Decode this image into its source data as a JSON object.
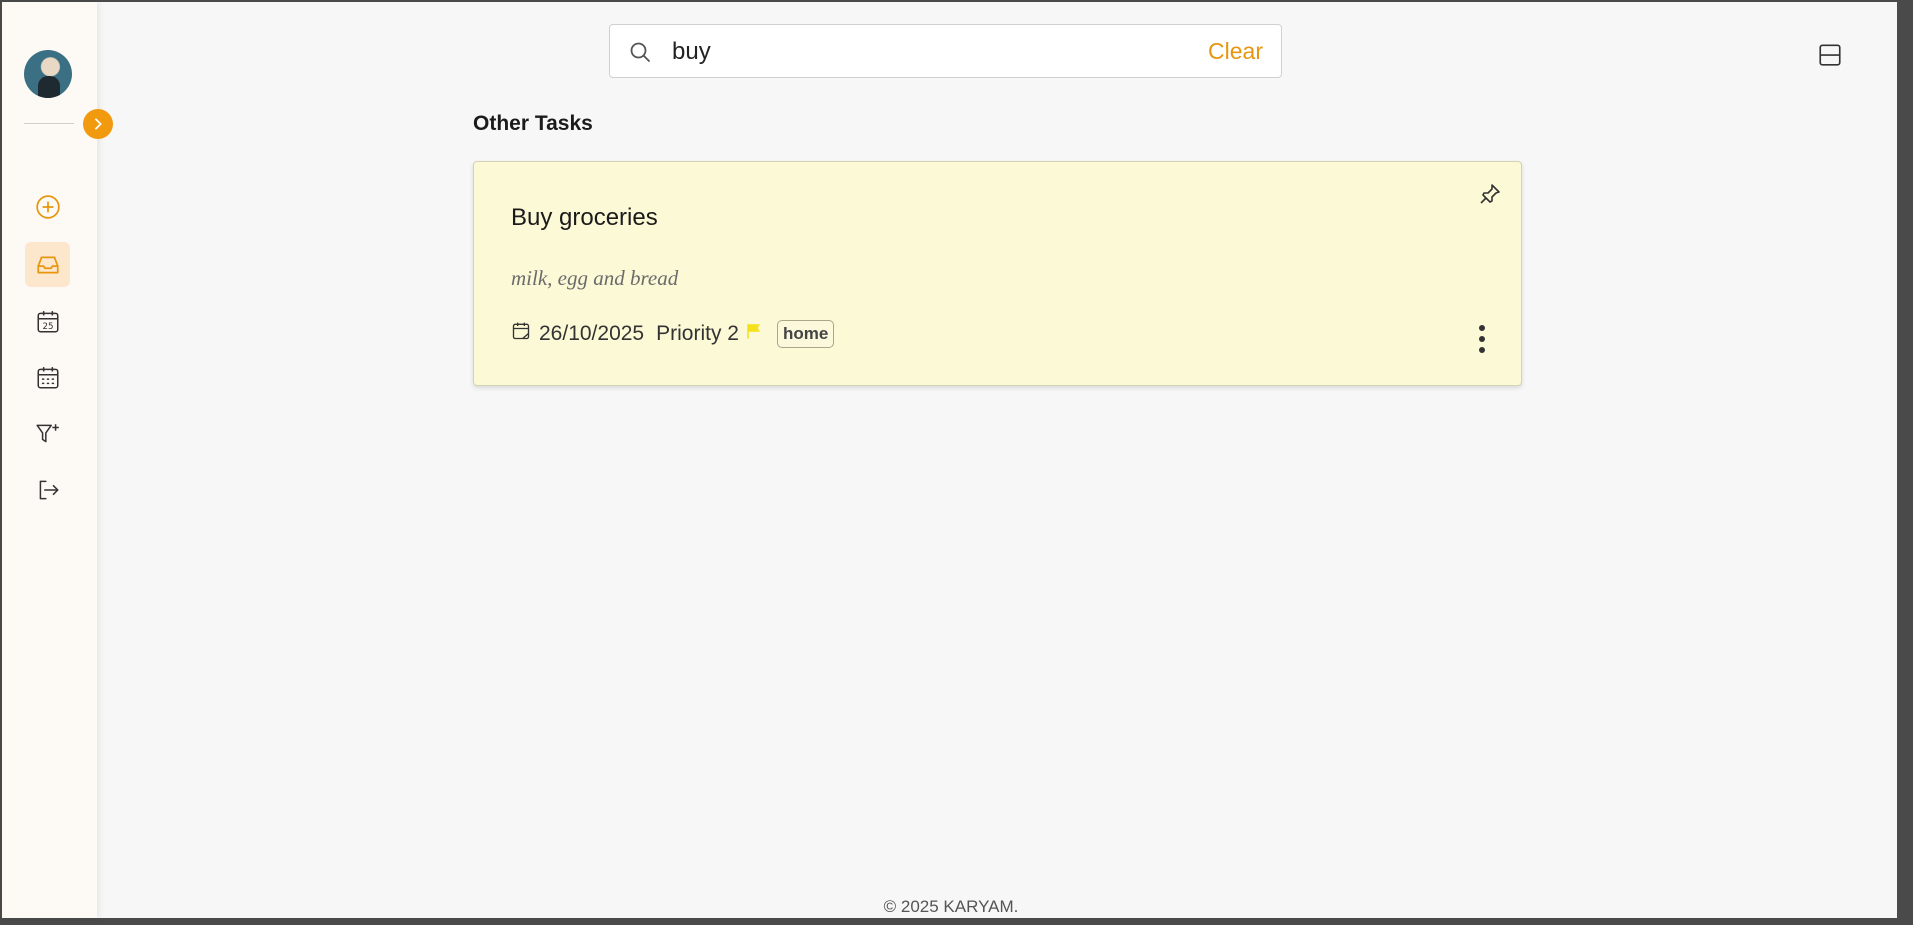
{
  "sidebar": {
    "items": [
      {
        "name": "add-task",
        "icon": "plus-circle-icon",
        "active": false
      },
      {
        "name": "inbox",
        "icon": "inbox-icon",
        "active": true
      },
      {
        "name": "today",
        "icon": "calendar-25-icon",
        "active": false
      },
      {
        "name": "upcoming",
        "icon": "calendar-grid-icon",
        "active": false
      },
      {
        "name": "filters",
        "icon": "filter-plus-icon",
        "active": false
      },
      {
        "name": "logout",
        "icon": "logout-icon",
        "active": false
      }
    ],
    "today_number": "25"
  },
  "search": {
    "value": "buy",
    "placeholder": "Search",
    "clear_label": "Clear"
  },
  "section": {
    "title": "Other Tasks"
  },
  "tasks": [
    {
      "title": "Buy groceries",
      "description": "milk, egg and bread",
      "date": "26/10/2025",
      "priority": "Priority 2",
      "tag": "home"
    }
  ],
  "footer": {
    "text": "© 2025 KARYAM."
  },
  "colors": {
    "accent": "#f29a0f",
    "card_bg": "#fcf9d6",
    "flag": "#f5e11a",
    "active_nav": "#fde7cc"
  }
}
